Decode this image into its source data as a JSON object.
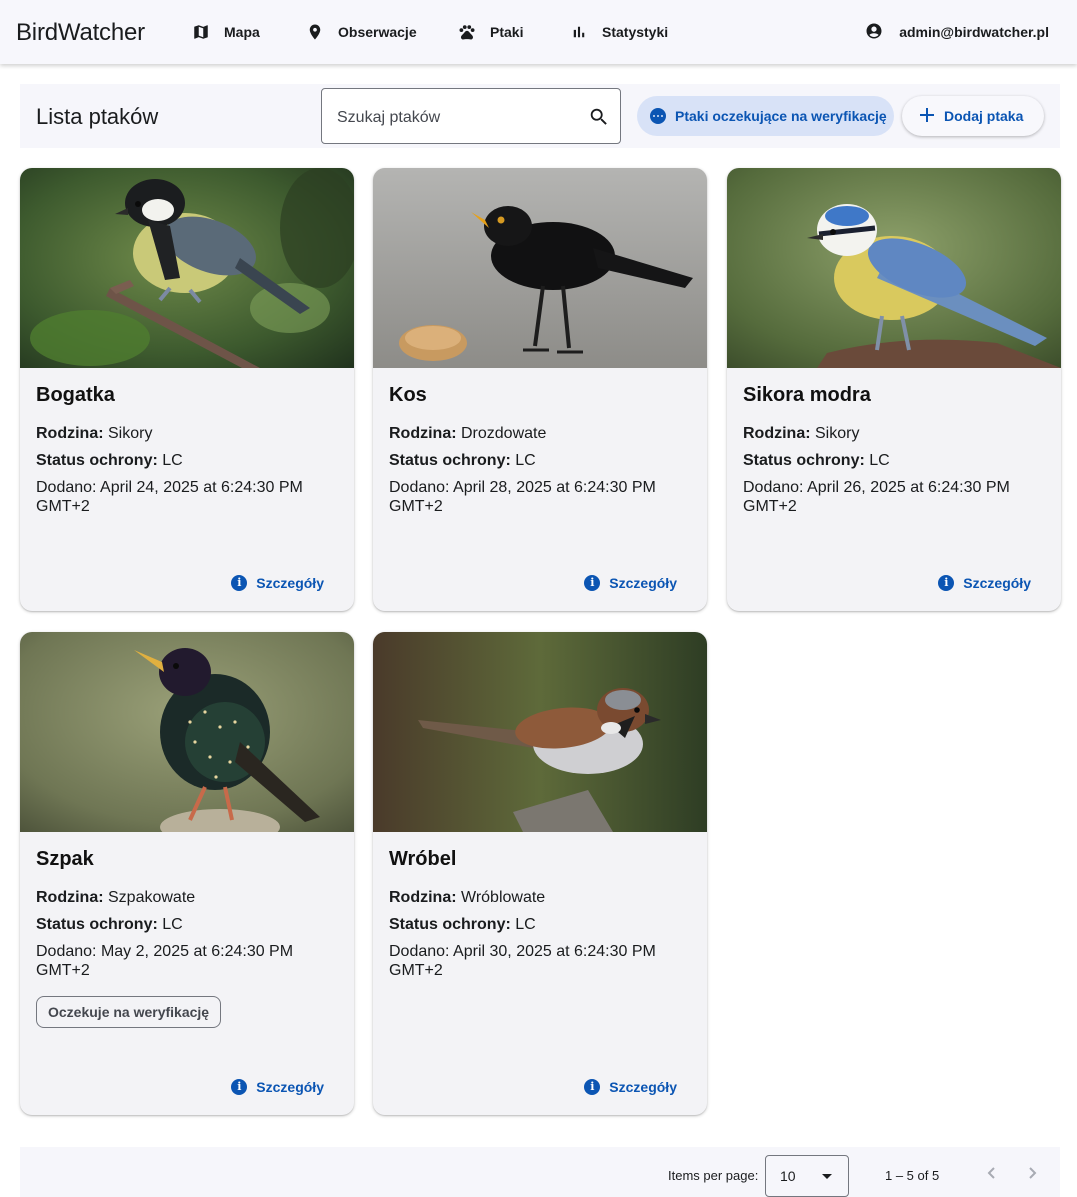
{
  "topbar": {
    "brand": "BirdWatcher",
    "nav": [
      {
        "label": "Mapa",
        "icon": "map-icon"
      },
      {
        "label": "Obserwacje",
        "icon": "location-pin-icon"
      },
      {
        "label": "Ptaki",
        "icon": "paw-icon"
      },
      {
        "label": "Statystyki",
        "icon": "bar-chart-icon"
      }
    ],
    "user": {
      "label": "admin@birdwatcher.pl",
      "icon": "account-circle-icon"
    }
  },
  "header": {
    "title": "Lista ptaków",
    "search_placeholder": "Szukaj ptaków",
    "pending_button": "Ptaki oczekujące na weryfikację",
    "add_button": "Dodaj ptaka"
  },
  "labels": {
    "family": "Rodzina:",
    "status": "Status ochrony:",
    "details": "Szczegóły",
    "info_glyph": "i"
  },
  "birds": [
    {
      "name": "Bogatka",
      "family": "Sikory",
      "status": "LC",
      "added": "Dodano: April 24, 2025 at 6:24:30 PM GMT+2",
      "photo": "great-tit-photo"
    },
    {
      "name": "Kos",
      "family": "Drozdowate",
      "status": "LC",
      "added": "Dodano: April 28, 2025 at 6:24:30 PM GMT+2",
      "photo": "blackbird-photo"
    },
    {
      "name": "Sikora modra",
      "family": "Sikory",
      "status": "LC",
      "added": "Dodano: April 26, 2025 at 6:24:30 PM GMT+2",
      "photo": "blue-tit-photo"
    },
    {
      "name": "Szpak",
      "family": "Szpakowate",
      "status": "LC",
      "added": "Dodano: May 2, 2025 at 6:24:30 PM GMT+2",
      "badge": "Oczekuje na weryfikację",
      "photo": "starling-photo"
    },
    {
      "name": "Wróbel",
      "family": "Wróblowate",
      "status": "LC",
      "added": "Dodano: April 30, 2025 at 6:24:30 PM GMT+2",
      "photo": "sparrow-photo"
    }
  ],
  "paginator": {
    "items_per_page_label": "Items per page:",
    "page_size": "10",
    "range": "1 – 5 of 5"
  },
  "colors": {
    "primary": "#0b55b3",
    "pending_bg": "#d8e2f7",
    "card_bg": "#f3f3f6"
  }
}
